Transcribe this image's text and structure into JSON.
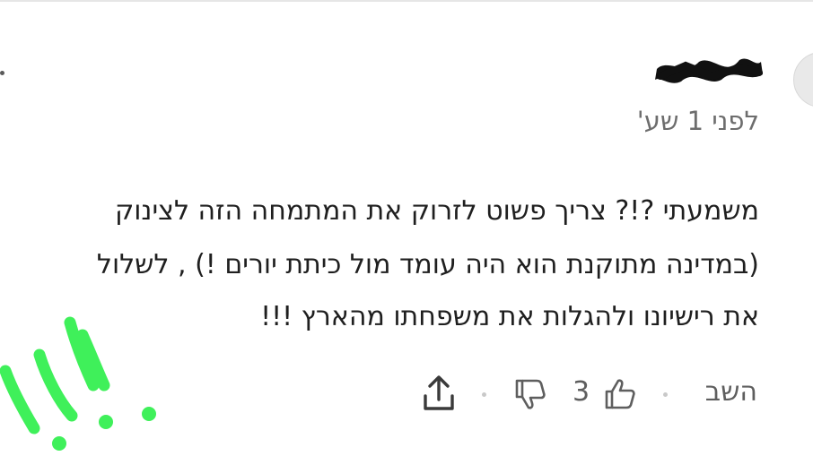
{
  "comment": {
    "author_redacted": true,
    "timestamp": "לפני 1 שע'",
    "text_lines": [
      "משמעתי ?!? צריך פשוט לזרוק את המתמחה הזה לצינוק",
      "(במדינה מתוקנת הוא היה עומד מול כיתת יורים !) , לשלול",
      "את רישיונו ולהגלות את משפחתו מהארץ !!!"
    ]
  },
  "actions": {
    "reply_label": "השב",
    "like_count": "3",
    "like_icon": "thumbs-up-icon",
    "dislike_icon": "thumbs-down-icon",
    "share_icon": "share-upload-icon"
  },
  "colors": {
    "annotation": "#3ff05a",
    "redaction": "#111111",
    "secondary_text": "#6d6d6d"
  }
}
